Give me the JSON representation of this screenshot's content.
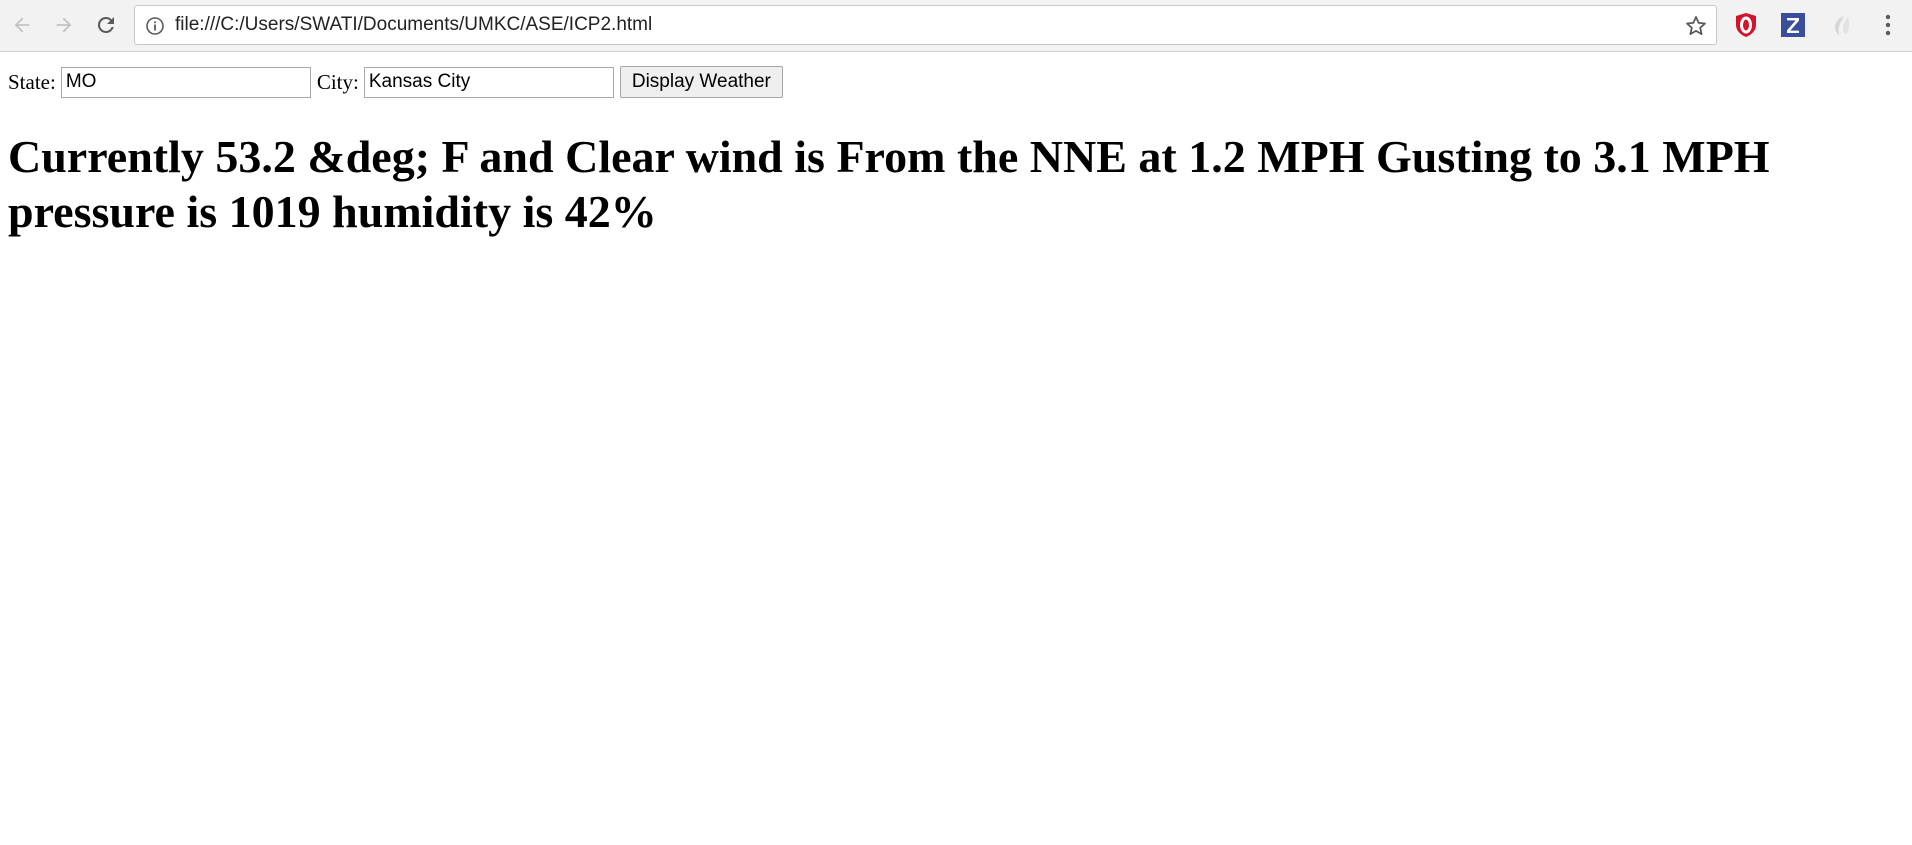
{
  "browser": {
    "address_bar": {
      "url": "file:///C:/Users/SWATI/Documents/UMKC/ASE/ICP2.html"
    },
    "icons": {
      "back": "arrow-left-icon",
      "forward": "arrow-right-icon",
      "reload": "reload-icon",
      "info": "info-icon",
      "bookmark": "star-icon",
      "extensions": [
        "opera-adblock-icon",
        "zotero-icon",
        "ghost-extension-icon"
      ],
      "menu": "kebab-menu-icon"
    },
    "colors": {
      "toolbar_bg": "#f2f2f2",
      "opera_red": "#d3132a",
      "zotero_blue": "#3a4d9a"
    }
  },
  "form": {
    "state_label": "State:",
    "state_value": "MO",
    "city_label": "City:",
    "city_value": "Kansas City",
    "submit_label": "Display Weather"
  },
  "weather": {
    "text": "Currently 53.2 &deg; F and Clear wind is From the NNE at 1.2 MPH Gusting to 3.1 MPH pressure is 1019 humidity is 42%"
  }
}
